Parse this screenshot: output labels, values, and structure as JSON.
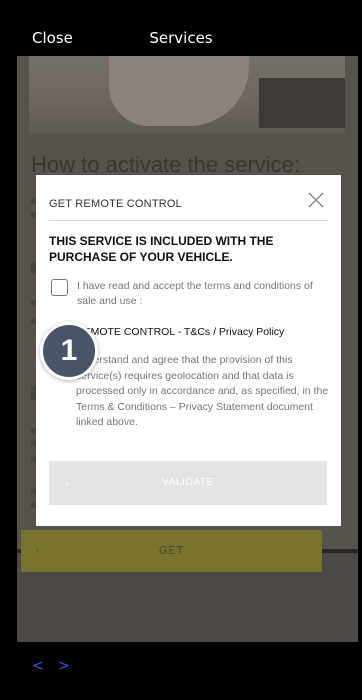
{
  "header": {
    "close_label": "Close",
    "title": "Services"
  },
  "background": {
    "heading": "How to activate the service:",
    "get_button": "GET"
  },
  "modal": {
    "title": "GET REMOTE CONTROL",
    "heading": "THIS SERVICE IS INCLUDED WITH THE PURCHASE OF YOUR VEHICLE.",
    "terms_text": "I have read and accept the terms and conditions of sale and use :",
    "policy_link": "REMOTE CONTROL - T&Cs / Privacy Policy",
    "consent_text": "understand and agree that the provision of this service(s) requires geolocation and that data is processed only in accordance and, as specified, in the Terms & Conditions – Privacy Statement document linked above.",
    "validate_label": "VALIDATE",
    "checkbox_checked": false
  },
  "step_badge": "1",
  "bottom_nav": {
    "back": "<",
    "forward": ">"
  },
  "colors": {
    "accent_blue": "#3a56e6",
    "badge": "#4a5568",
    "get_button_dimmed": "#77722e"
  }
}
